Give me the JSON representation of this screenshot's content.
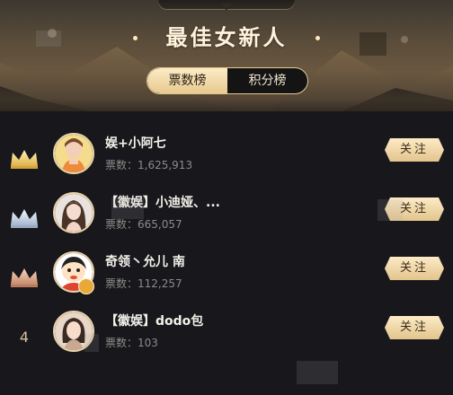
{
  "header": {
    "title": "最佳女新人",
    "tabs": [
      {
        "label": "票数榜",
        "active": true
      },
      {
        "label": "积分榜",
        "active": false
      }
    ]
  },
  "ranking": [
    {
      "rank": "1",
      "rank_icon": "gold-crown-icon",
      "name": "娱+小阿七",
      "votes": "票数：1,625,913",
      "follow_label": "关注",
      "avatar": "avatar-orange-top-woman"
    },
    {
      "rank": "2",
      "rank_icon": "silver-crown-icon",
      "name": "【徽娱】小迪娅、...",
      "votes": "票数：665,057",
      "follow_label": "关注",
      "avatar": "avatar-long-hair-woman"
    },
    {
      "rank": "3",
      "rank_icon": "bronze-crown-icon",
      "name": "奇领丶允儿 南",
      "votes": "票数：112,257",
      "follow_label": "关注",
      "avatar": "avatar-cartoon-boy"
    },
    {
      "rank": "4",
      "rank_icon": "",
      "name": "【徽娱】dodo包",
      "votes": "票数：103",
      "follow_label": "关注",
      "avatar": "avatar-woman-dark-hair"
    }
  ],
  "colors": {
    "accent_gold": "#e7c98e",
    "background": "#17171c",
    "name_text": "#f3f0e8",
    "votes_text": "#8e8b86"
  }
}
